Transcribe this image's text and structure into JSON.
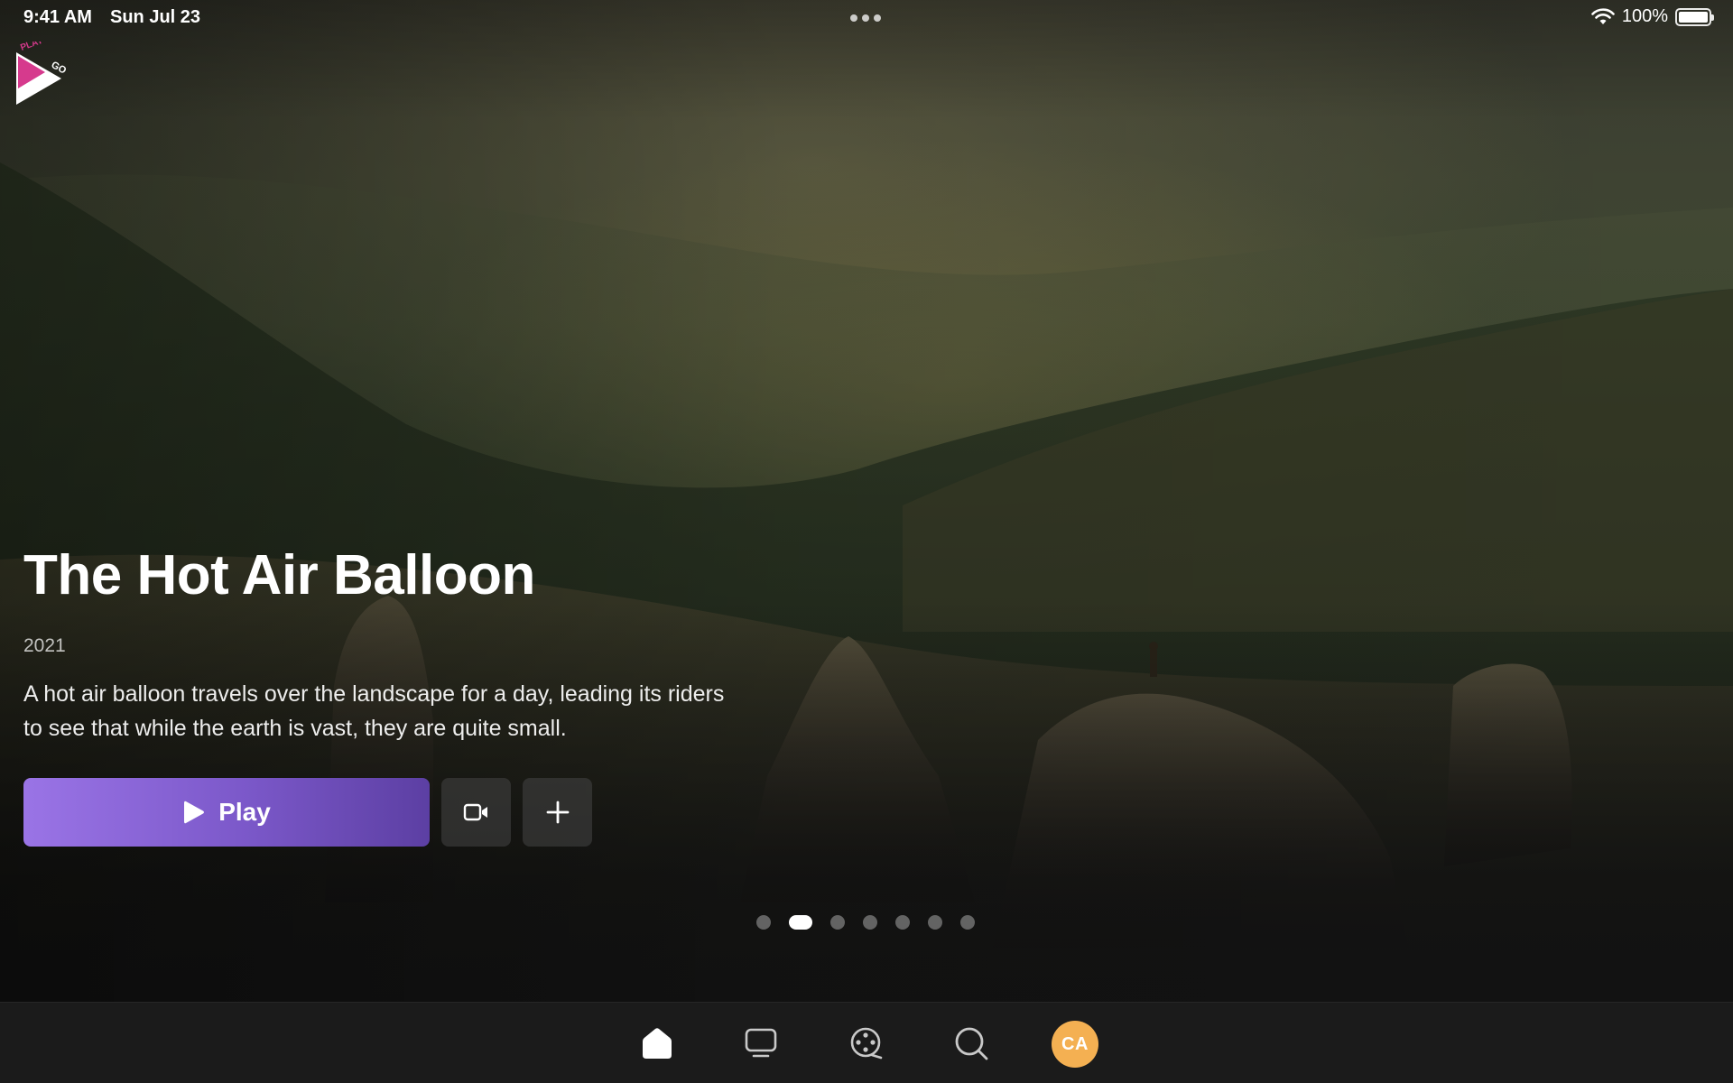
{
  "status_bar": {
    "time": "9:41 AM",
    "date": "Sun Jul 23",
    "battery_percent": "100%",
    "battery_level": 1.0
  },
  "brand": {
    "logo_text_top": "PLAY",
    "logo_text_side": "GO",
    "colors": {
      "pink": "#d63a8d",
      "white": "#ffffff"
    }
  },
  "featured": {
    "title": "The Hot Air Balloon",
    "year": "2021",
    "description": "A hot air balloon travels over the landscape for a day, leading its riders to see that while the earth is vast, they are quite small.",
    "play_label": "Play",
    "trailer_icon": "video-camera-icon",
    "add_icon": "plus-icon",
    "accent_color": "#8b66da"
  },
  "carousel": {
    "total": 7,
    "active_index": 1
  },
  "tabbar": {
    "items": [
      {
        "name": "home",
        "icon": "home-icon",
        "active": true
      },
      {
        "name": "tv",
        "icon": "tv-icon",
        "active": false
      },
      {
        "name": "movies",
        "icon": "film-reel-icon",
        "active": false
      },
      {
        "name": "search",
        "icon": "search-icon",
        "active": false
      }
    ],
    "avatar_initials": "CA",
    "avatar_color": "#f4b052"
  }
}
